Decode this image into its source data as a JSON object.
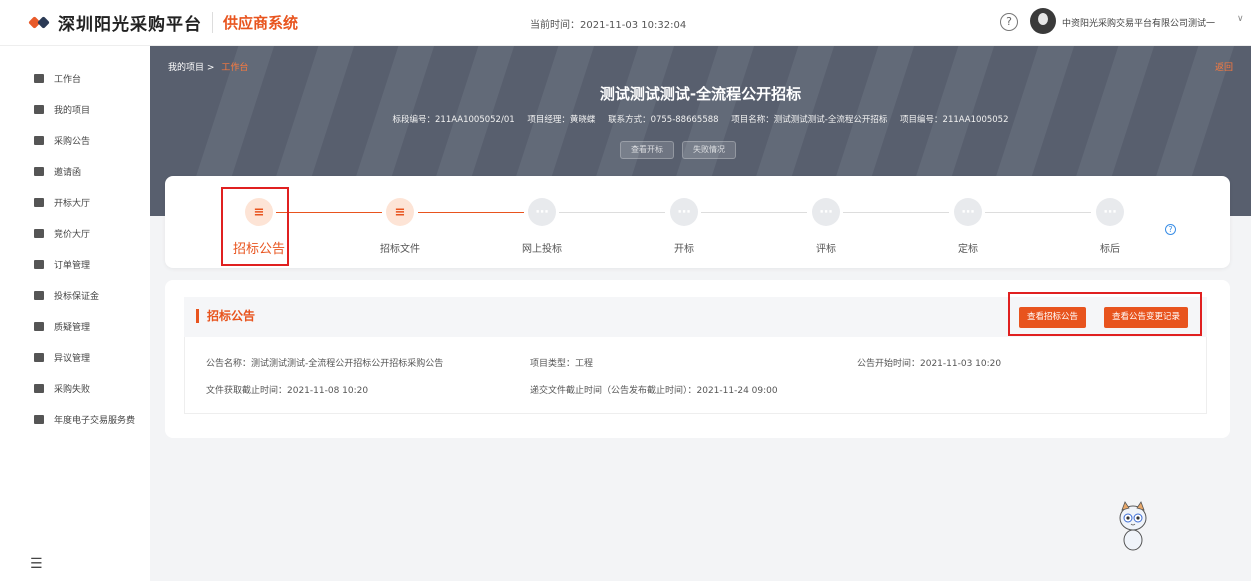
{
  "header": {
    "logo_title": "深圳阳光采购平台",
    "logo_subtitle": "供应商系统",
    "clock": "当前时间：2021-11-03 10:32:04",
    "help_glyph": "?",
    "user_name": "中资阳光采购交易平台有限公司测试一",
    "user_caret": "∨"
  },
  "sidebar": {
    "items": [
      {
        "label": "工作台"
      },
      {
        "label": "我的项目"
      },
      {
        "label": "采购公告"
      },
      {
        "label": "邀请函"
      },
      {
        "label": "开标大厅"
      },
      {
        "label": "竞价大厅"
      },
      {
        "label": "订单管理"
      },
      {
        "label": "投标保证金"
      },
      {
        "label": "质疑管理"
      },
      {
        "label": "异议管理"
      },
      {
        "label": "采购失败"
      },
      {
        "label": "年度电子交易服务费"
      }
    ],
    "collapse_glyph": "☰"
  },
  "banner": {
    "breadcrumb_root": "我的项目",
    "breadcrumb_sep": ">",
    "breadcrumb_current": "工作台",
    "back_label": "返回",
    "project_title": "测试测试测试-全流程公开招标",
    "info": [
      "标段编号：211AA1005052/01",
      "项目经理：黄晓蝶",
      "联系方式：0755-88665588",
      "项目名称：测试测试测试-全流程公开招标",
      "项目编号：211AA1005052"
    ],
    "buttons": [
      "查看开标",
      "失败情况"
    ]
  },
  "steps": [
    {
      "label": "招标公告",
      "state": "active"
    },
    {
      "label": "招标文件",
      "state": "done"
    },
    {
      "label": "网上投标",
      "state": "todo"
    },
    {
      "label": "开标",
      "state": "todo"
    },
    {
      "label": "评标",
      "state": "todo"
    },
    {
      "label": "定标",
      "state": "todo"
    },
    {
      "label": "标后",
      "state": "todo"
    }
  ],
  "announcement": {
    "title": "招标公告",
    "btn_view": "查看招标公告",
    "btn_changes": "查看公告变更记录",
    "fields": {
      "name": "公告名称：测试测试测试-全流程公开招标公开招标采购公告",
      "type": "项目类型：工程",
      "start": "公告开始时间：2021-11-03 10:20",
      "doc_deadline": "文件获取截止时间：2021-11-08 10:20",
      "submit_deadline": "递交文件截止时间（公告发布截止时间）：2021-11-24 09:00"
    }
  },
  "colors": {
    "accent": "#e8541e",
    "highlight": "#e02020",
    "banner": "#585f6e"
  }
}
